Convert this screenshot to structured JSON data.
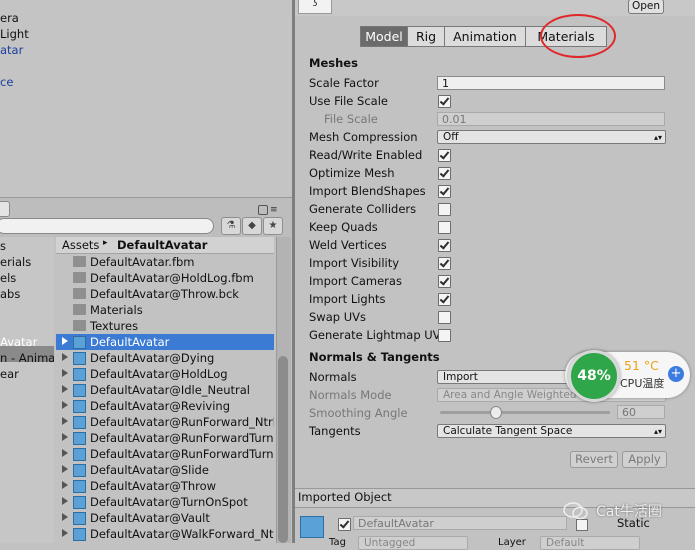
{
  "hierarchy": {
    "items": [
      "era",
      "Light",
      "atar",
      "",
      "ce"
    ],
    "colors": [
      "#111111",
      "#111111",
      "#1a3da0",
      "#1a3da0",
      "#1a3da0"
    ]
  },
  "project_tree": {
    "items": [
      "s",
      "erials",
      "els",
      "abs",
      "",
      "",
      "Avatar",
      "n - Anima",
      "ear"
    ]
  },
  "breadcrumb": {
    "root": "Assets",
    "separator": "▸",
    "current": "DefaultAvatar"
  },
  "files": [
    {
      "name": "DefaultAvatar.fbm",
      "icon": "folder-icon",
      "expand": false
    },
    {
      "name": "DefaultAvatar@HoldLog.fbm",
      "icon": "folder-icon",
      "expand": false
    },
    {
      "name": "DefaultAvatar@Throw.bck",
      "icon": "folder-icon",
      "expand": false
    },
    {
      "name": "Materials",
      "icon": "folder-icon",
      "expand": false
    },
    {
      "name": "Textures",
      "icon": "folder-icon",
      "expand": false
    },
    {
      "name": "DefaultAvatar",
      "icon": "model-icon",
      "expand": true,
      "selected": true
    },
    {
      "name": "DefaultAvatar@Dying",
      "icon": "model-icon",
      "expand": true
    },
    {
      "name": "DefaultAvatar@HoldLog",
      "icon": "model-icon",
      "expand": true
    },
    {
      "name": "DefaultAvatar@Idle_Neutral",
      "icon": "model-icon",
      "expand": true
    },
    {
      "name": "DefaultAvatar@Reviving",
      "icon": "model-icon",
      "expand": true
    },
    {
      "name": "DefaultAvatar@RunForward_Ntrl",
      "icon": "model-icon",
      "expand": true
    },
    {
      "name": "DefaultAvatar@RunForwardTurn",
      "icon": "model-icon",
      "expand": true
    },
    {
      "name": "DefaultAvatar@RunForwardTurn",
      "icon": "model-icon",
      "expand": true
    },
    {
      "name": "DefaultAvatar@Slide",
      "icon": "model-icon",
      "expand": true
    },
    {
      "name": "DefaultAvatar@Throw",
      "icon": "model-icon",
      "expand": true
    },
    {
      "name": "DefaultAvatar@TurnOnSpot",
      "icon": "model-icon",
      "expand": true
    },
    {
      "name": "DefaultAvatar@Vault",
      "icon": "model-icon",
      "expand": true
    },
    {
      "name": "DefaultAvatar@WalkForward_Ntr",
      "icon": "model-icon",
      "expand": true
    }
  ],
  "inspector": {
    "open_label": "Open",
    "preview_glyph": "ʖ",
    "tabs": [
      "Model",
      "Rig",
      "Animation",
      "Materials"
    ],
    "active_tab": "Model",
    "highlight_color": "#e0282b",
    "meshes": {
      "title": "Meshes",
      "scale_factor_label": "Scale Factor",
      "scale_factor": "1",
      "use_file_scale_label": "Use File Scale",
      "use_file_scale": true,
      "file_scale_label": "File Scale",
      "file_scale": "0.01",
      "mesh_compression_label": "Mesh Compression",
      "mesh_compression": "Off",
      "checks": [
        {
          "label": "Read/Write Enabled",
          "checked": true
        },
        {
          "label": "Optimize Mesh",
          "checked": true
        },
        {
          "label": "Import BlendShapes",
          "checked": true
        },
        {
          "label": "Generate Colliders",
          "checked": false
        },
        {
          "label": "Keep Quads",
          "checked": false
        },
        {
          "label": "Weld Vertices",
          "checked": true
        },
        {
          "label": "Import Visibility",
          "checked": true
        },
        {
          "label": "Import Cameras",
          "checked": true
        },
        {
          "label": "Import Lights",
          "checked": true
        },
        {
          "label": "Swap UVs",
          "checked": false
        },
        {
          "label": "Generate Lightmap UVs",
          "checked": false
        }
      ]
    },
    "normals": {
      "title": "Normals & Tangents",
      "normals_label": "Normals",
      "normals_value": "Import",
      "normals_mode_label": "Normals Mode",
      "normals_mode_value": "Area and Angle Weighted",
      "smoothing_label": "Smoothing Angle",
      "smoothing_value": "60",
      "smoothing_fraction": 0.33,
      "tangents_label": "Tangents",
      "tangents_value": "Calculate Tangent Space"
    },
    "revert_label": "Revert",
    "apply_label": "Apply",
    "imported": {
      "title": "Imported Object",
      "name": "DefaultAvatar",
      "static_label": "Static",
      "tag_label": "Tag",
      "tag_value": "Untagged",
      "layer_label": "Layer",
      "layer_value": "Default"
    }
  },
  "cpu_widget": {
    "usage": "48%",
    "temp": "51 °C",
    "label": "CPU温度",
    "plus": "+",
    "ring_color": "#2fa64a",
    "temp_color": "#e8a317"
  },
  "watermark": {
    "text": "Cat牛活圈"
  }
}
